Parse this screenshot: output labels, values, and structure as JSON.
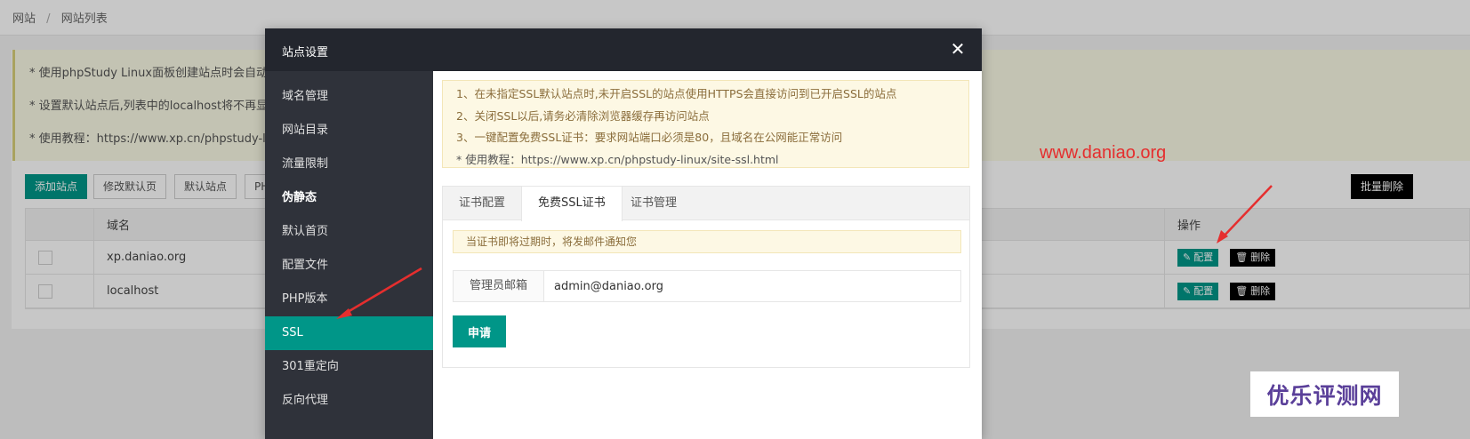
{
  "breadcrumb": {
    "root": "网站",
    "separator": "/",
    "current": "网站列表"
  },
  "notice": {
    "lines": [
      "* 使用phpStudy Linux面板创建站点时会自动",
      "* 设置默认站点后,列表中的localhost将不再显",
      "* 使用教程：https://www.xp.cn/phpstudy-lin"
    ]
  },
  "toolbar": {
    "add_site": "添加站点",
    "modify_default": "修改默认页",
    "default_site": "默认站点",
    "php": "PH",
    "batch_delete": "批量删除"
  },
  "table": {
    "headers": {
      "domain": "域名",
      "actions": "操作"
    },
    "rows": [
      {
        "domain": "xp.daniao.org",
        "config": "配置",
        "delete": "删除"
      },
      {
        "domain": "localhost",
        "config": "配置",
        "delete": "删除"
      }
    ]
  },
  "modal": {
    "title": "站点设置",
    "close_icon": "close-icon",
    "sidebar": [
      {
        "label": "域名管理"
      },
      {
        "label": "网站目录"
      },
      {
        "label": "流量限制"
      },
      {
        "label": "伪静态"
      },
      {
        "label": "默认首页"
      },
      {
        "label": "配置文件"
      },
      {
        "label": "PHP版本"
      },
      {
        "label": "SSL"
      },
      {
        "label": "301重定向"
      },
      {
        "label": "反向代理"
      }
    ],
    "active_item": "SSL",
    "tips": [
      "1、在未指定SSL默认站点时,未开启SSL的站点使用HTTPS会直接访问到已开启SSL的站点",
      "2、关闭SSL以后,请务必清除浏览器缓存再访问站点",
      "3、一键配置免费SSL证书：要求网站端口必须是80，且域名在公网能正常访问",
      "* 使用教程：https://www.xp.cn/phpstudy-linux/site-ssl.html"
    ],
    "tabs": [
      {
        "label": "证书配置"
      },
      {
        "label": "免费SSL证书"
      },
      {
        "label": "证书管理"
      }
    ],
    "active_tab": "免费SSL证书",
    "expire_notice": "当证书即将过期时，将发邮件通知您",
    "email_label": "管理员邮箱",
    "email_value": "admin@daniao.org",
    "apply_button": "申请"
  },
  "annotations": {
    "watermark_url": "www.daniao.org",
    "logo_text": "优乐评测网",
    "arrow_color": "#e52e2e"
  },
  "colors": {
    "accent": "#009688",
    "header_dark": "#23262e",
    "sidebar": "#2f323a"
  }
}
